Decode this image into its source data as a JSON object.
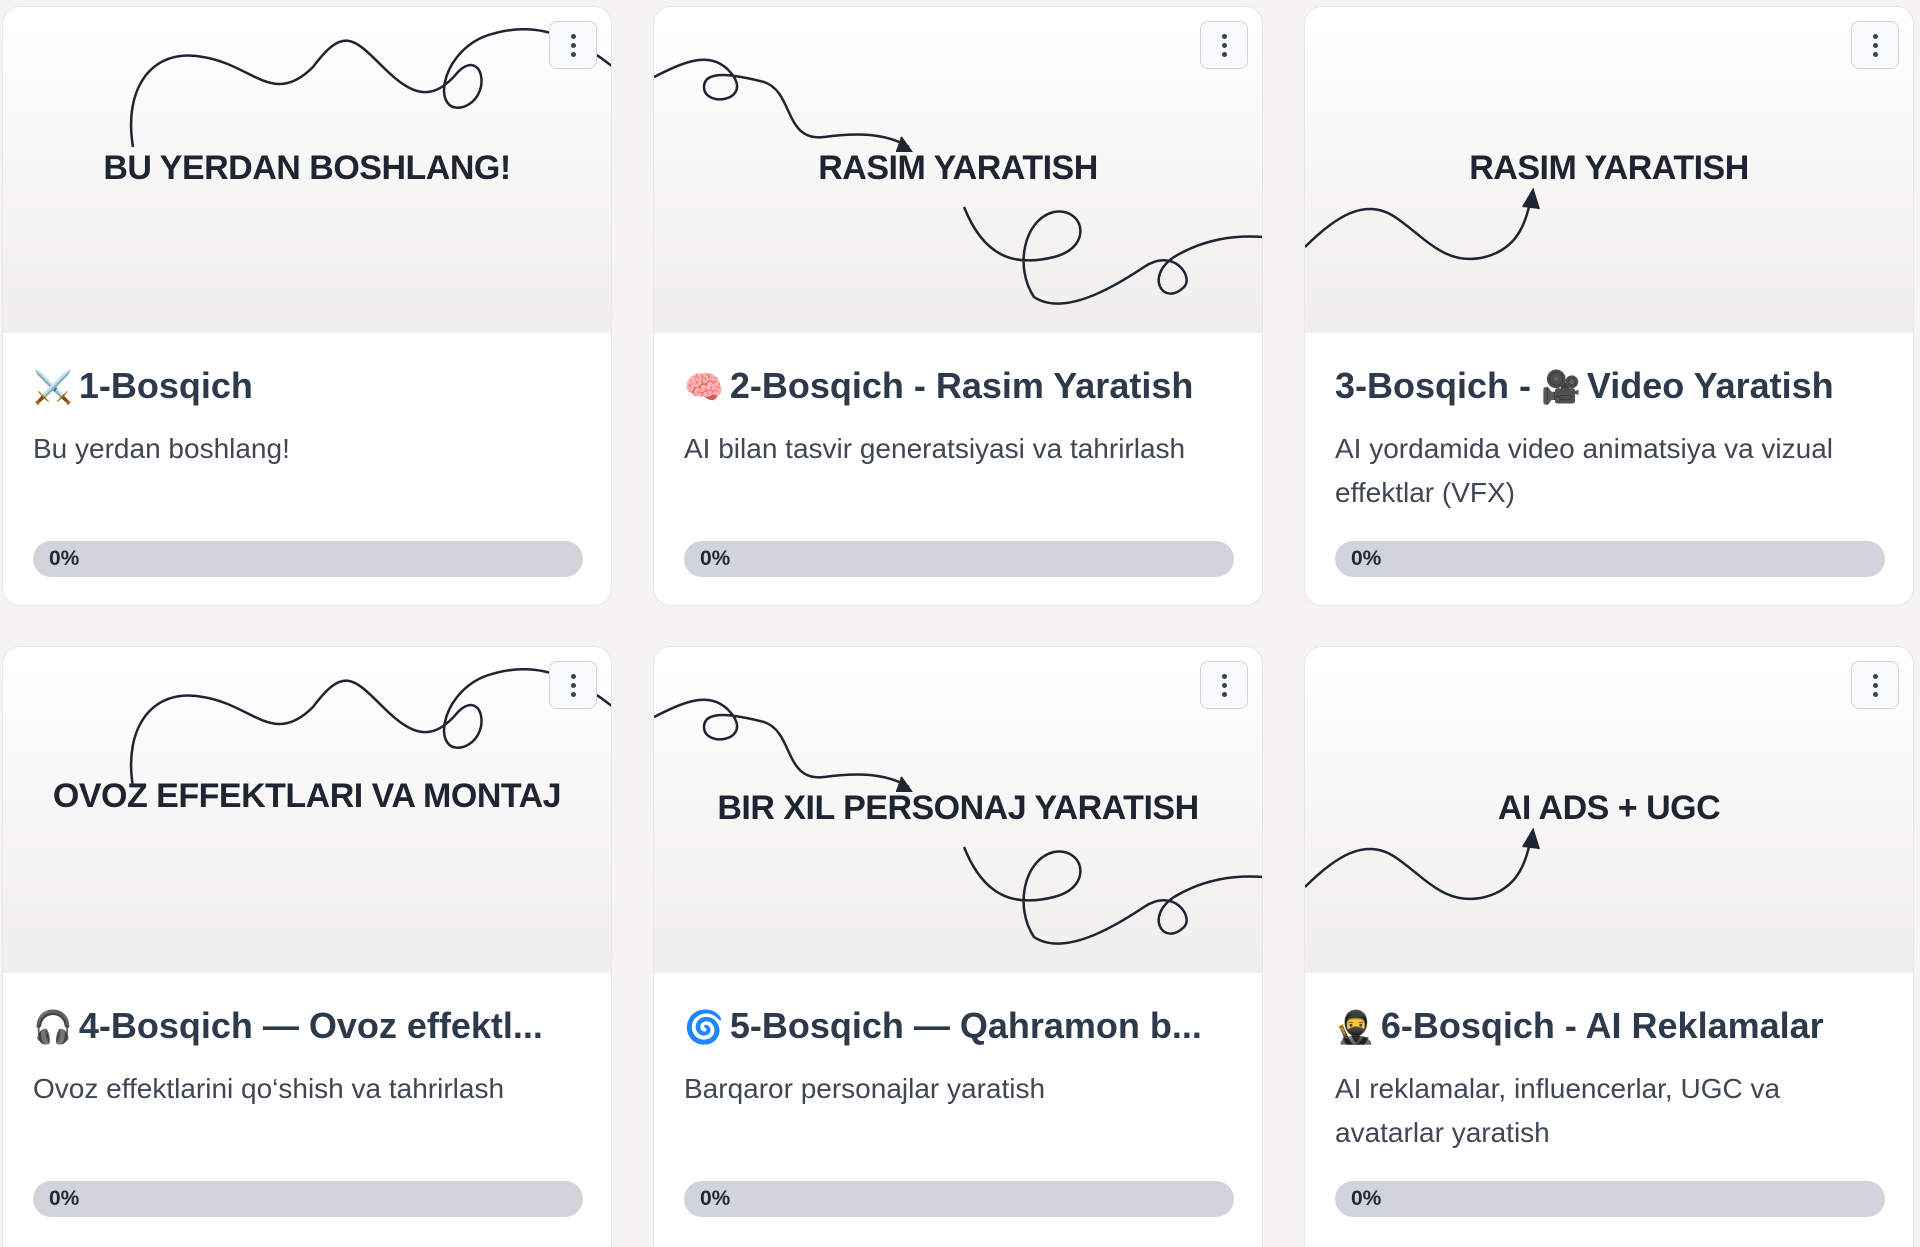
{
  "cards": [
    {
      "thumb_title": "BU YERDAN BOSHLANG!",
      "emoji": "⚔️",
      "emoji_icon": "crossed-swords-icon",
      "title": "1-Bosqich",
      "description": "Bu yerdan boshlang!",
      "progress_label": "0%",
      "progress": 0
    },
    {
      "thumb_title": "RASIM YARATISH",
      "emoji": "🧠",
      "emoji_icon": "brain-icon",
      "title": "2-Bosqich - Rasim Yaratish",
      "description": "AI bilan tasvir generatsiyasi va tahrirlash",
      "progress_label": "0%",
      "progress": 0
    },
    {
      "thumb_title": "RASIM YARATISH",
      "emoji": "🎥",
      "emoji_icon": "movie-camera-icon",
      "title_prefix": "3-Bosqich - ",
      "title": "Video Yaratish",
      "description": "AI yordamida video animatsiya va vizual effektlar (VFX)",
      "progress_label": "0%",
      "progress": 0
    },
    {
      "thumb_title": "OVOZ EFFEKTLARI VA MONTAJ",
      "emoji": "🎧",
      "emoji_icon": "headphones-icon",
      "title": "4-Bosqich — Ovoz effektl...",
      "description": "Ovoz effektlarini qo‘shish va tahrirlash",
      "progress_label": "0%",
      "progress": 0
    },
    {
      "thumb_title": "BIR XIL PERSONAJ YARATISH",
      "emoji": "🌀",
      "emoji_icon": "cyclone-icon",
      "title": "5-Bosqich — Qahramon b...",
      "description": "Barqaror personajlar yaratish",
      "progress_label": "0%",
      "progress": 0
    },
    {
      "thumb_title": "AI ADS + UGC",
      "emoji": "🥷",
      "emoji_icon": "ninja-icon",
      "title": "6-Bosqich - AI Reklamalar",
      "description": "AI reklamalar, influencerlar, UGC va avatarlar yaratish",
      "progress_label": "0%",
      "progress": 0
    }
  ],
  "icons": {
    "menu": "kebab-menu-icon"
  },
  "colors": {
    "card_bg": "#ffffff",
    "title": "#2c3a4b",
    "progress_track": "#d1d5db"
  }
}
